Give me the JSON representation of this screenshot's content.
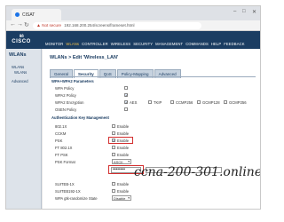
{
  "browser": {
    "tab_title": "CISAT",
    "url_warning": "Not secure",
    "url": "192.168.200.254/screens/frameset.html"
  },
  "header": {
    "brand_bars": "ılıılı",
    "brand": "CISCO",
    "menu": [
      "MONITOR",
      "WLANs",
      "CONTROLLER",
      "WIRELESS",
      "SECURITY",
      "MANAGEMENT",
      "COMMANDS",
      "HELP",
      "FEEDBACK"
    ]
  },
  "sidebar": {
    "title": "WLANs",
    "items": [
      "WLANs",
      "WLANs",
      "Advanced"
    ]
  },
  "content": {
    "title": "WLANs > Edit 'Wireless_LAN'",
    "tabs": [
      "General",
      "Security",
      "QoS",
      "Policy-Mapping",
      "Advanced"
    ],
    "sections": {
      "wpa": "WPA+WPA2 Parameters",
      "auth": "Authentication Key Management"
    },
    "wpa_rows": [
      "WPA Policy",
      "WPA2 Policy",
      "WPA2 Encryption",
      "OSEN Policy"
    ],
    "encryption": [
      "AES",
      "TKIP",
      "CCMP256",
      "GCMP128",
      "GCMP256"
    ],
    "auth_rows": [
      "802.1X",
      "CCKM",
      "PSK",
      "FT 802.1X",
      "FT PSK",
      "PSK Format",
      "",
      "SUITEB-1X",
      "SUITEB192-1X",
      "WPA gtk-randomize State"
    ],
    "enable_label": "Enable",
    "psk_format": "ASCII",
    "psk_value": "••••••••",
    "gtk_state": "Disable"
  },
  "watermark": "ccna-200-301.online"
}
